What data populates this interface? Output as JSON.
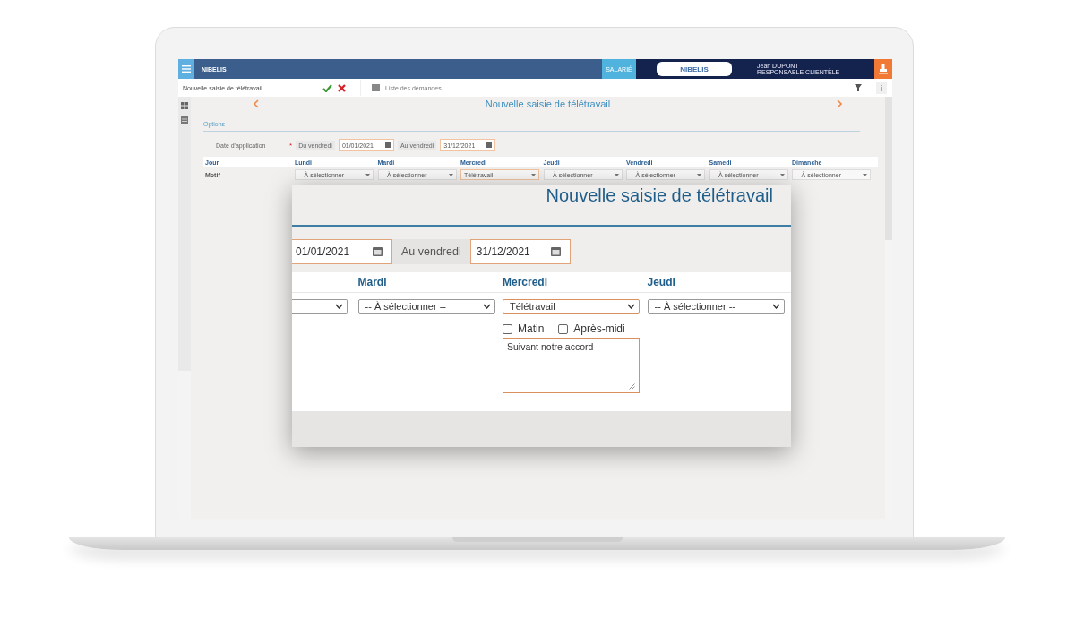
{
  "header": {
    "logo": "NIBELIS",
    "role_tab": "SALARIÉ",
    "center_logo": "NIBELIS",
    "user_name": "Jean DUPONT",
    "user_role": "RESPONSABLE CLIENTÈLE"
  },
  "toolbar": {
    "title": "Nouvelle saisie de télétravail",
    "list_link": "Liste des demandes"
  },
  "page": {
    "title": "Nouvelle saisie de télétravail",
    "section": "Options",
    "date_label": "Date d'application",
    "required_mark": "*",
    "from_label": "Du vendredi",
    "from": "01/01/2021",
    "to_label": "Au vendredi",
    "to": "31/12/2021"
  },
  "schedule": {
    "label_column": "Jour",
    "columns": [
      "Lundi",
      "Mardi",
      "Mercredi",
      "Jeudi",
      "Vendredi",
      "Samedi",
      "Dimanche"
    ],
    "rows": [
      {
        "label": "Motif",
        "cells": [
          {
            "value": "-- À sélectionner --",
            "highlighted": false
          },
          {
            "value": "-- À sélectionner --",
            "highlighted": false
          },
          {
            "value": "Télétravail",
            "highlighted": true
          },
          {
            "value": "-- À sélectionner --",
            "highlighted": false
          },
          {
            "value": "-- À sélectionner --",
            "highlighted": false
          },
          {
            "value": "-- À sélectionner --",
            "highlighted": false
          },
          {
            "value": "-- À sélectionner --",
            "highlighted": false
          }
        ]
      }
    ]
  },
  "zoom": {
    "title": "Nouvelle saisie de télétravail",
    "from": "01/01/2021",
    "to_label": "Au vendredi",
    "to": "31/12/2021",
    "columns": [
      "Mardi",
      "Mercredi",
      "Jeudi"
    ],
    "selects": [
      {
        "value": "-- À sélectionner --",
        "highlighted": false
      },
      {
        "value": "Télétravail",
        "highlighted": true
      },
      {
        "value": "-- À sélectionner --",
        "highlighted": false
      }
    ],
    "options": [
      {
        "label": "Matin",
        "checked": false
      },
      {
        "label": "Après-midi",
        "checked": false
      }
    ],
    "note": "Suivant notre accord"
  }
}
